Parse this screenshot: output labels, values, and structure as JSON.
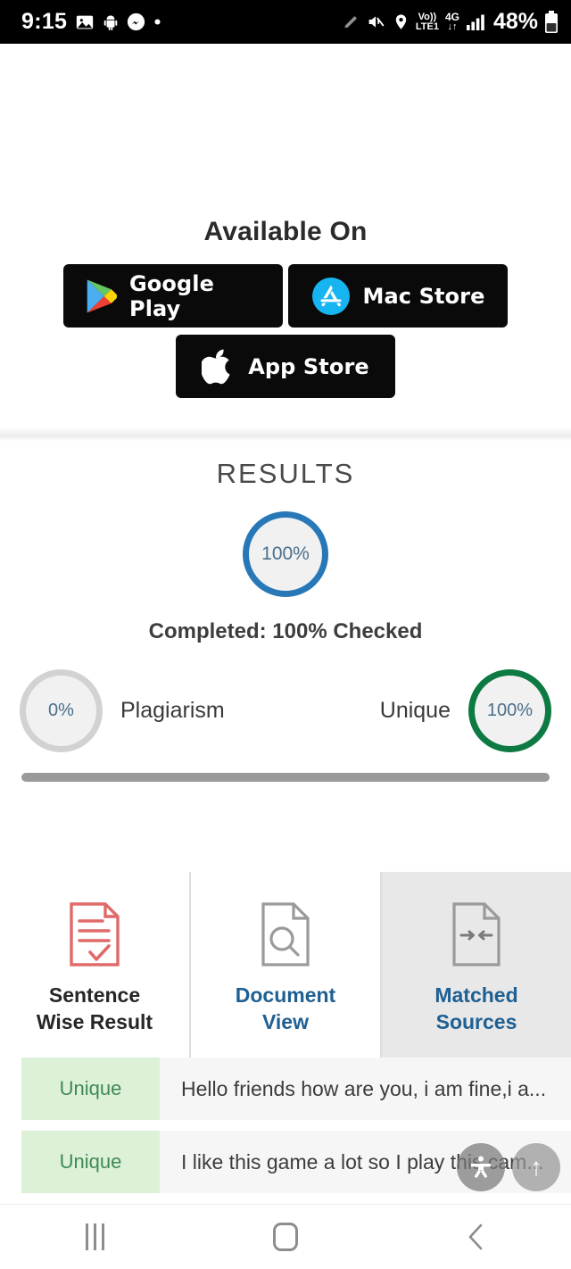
{
  "statusbar": {
    "time": "9:15",
    "icons_left": [
      "photo-icon",
      "android-icon",
      "messenger-icon",
      "dot-icon"
    ],
    "icons_right": [
      "pencil-icon",
      "mute-icon",
      "location-icon",
      "volte-icon",
      "4g-icon",
      "signal-icon"
    ],
    "volte_top": "Vo))",
    "volte_bottom": "LTE1",
    "network_top": "4G",
    "network_bottom": "↓↑",
    "battery": "48%"
  },
  "available": {
    "title": "Available On",
    "stores": [
      {
        "label": "Google Play",
        "icon": "google-play-icon"
      },
      {
        "label": "Mac Store",
        "icon": "mac-store-icon"
      },
      {
        "label": "App Store",
        "icon": "apple-icon"
      }
    ]
  },
  "results": {
    "title": "RESULTS",
    "main_percent": "100%",
    "completed_text": "Completed: 100% Checked",
    "plagiarism": {
      "percent": "0%",
      "label": "Plagiarism"
    },
    "unique": {
      "percent": "100%",
      "label": "Unique"
    }
  },
  "tabs": [
    {
      "line1": "Sentence",
      "line2": "Wise Result",
      "icon": "document-check-icon",
      "active": false
    },
    {
      "line1": "Document",
      "line2": "View",
      "icon": "document-search-icon",
      "active": false
    },
    {
      "line1": "Matched",
      "line2": "Sources",
      "icon": "document-arrows-icon",
      "active": true
    }
  ],
  "rows": [
    {
      "tag": "Unique",
      "text": "Hello friends how are you, i am fine,i a..."
    },
    {
      "tag": "Unique",
      "text": "I like this game a lot so I play this cam..."
    },
    {
      "tag": "",
      "text": ""
    }
  ],
  "fabs": [
    {
      "name": "accessibility-fab",
      "glyph": ""
    },
    {
      "name": "scroll-to-top-fab",
      "glyph": "↑"
    }
  ],
  "navbar": {
    "recent_label": "recent-apps-icon",
    "home_label": "home-icon",
    "back_label": "back-icon",
    "back_glyph": "‹"
  },
  "colors": {
    "accent_blue": "#2878b8",
    "green": "#0c7a42",
    "tag_green_bg": "#ddf0d8",
    "tag_green_text": "#3f8a56",
    "tab_blue": "#1f6093",
    "red_icon": "#e06a6a"
  }
}
